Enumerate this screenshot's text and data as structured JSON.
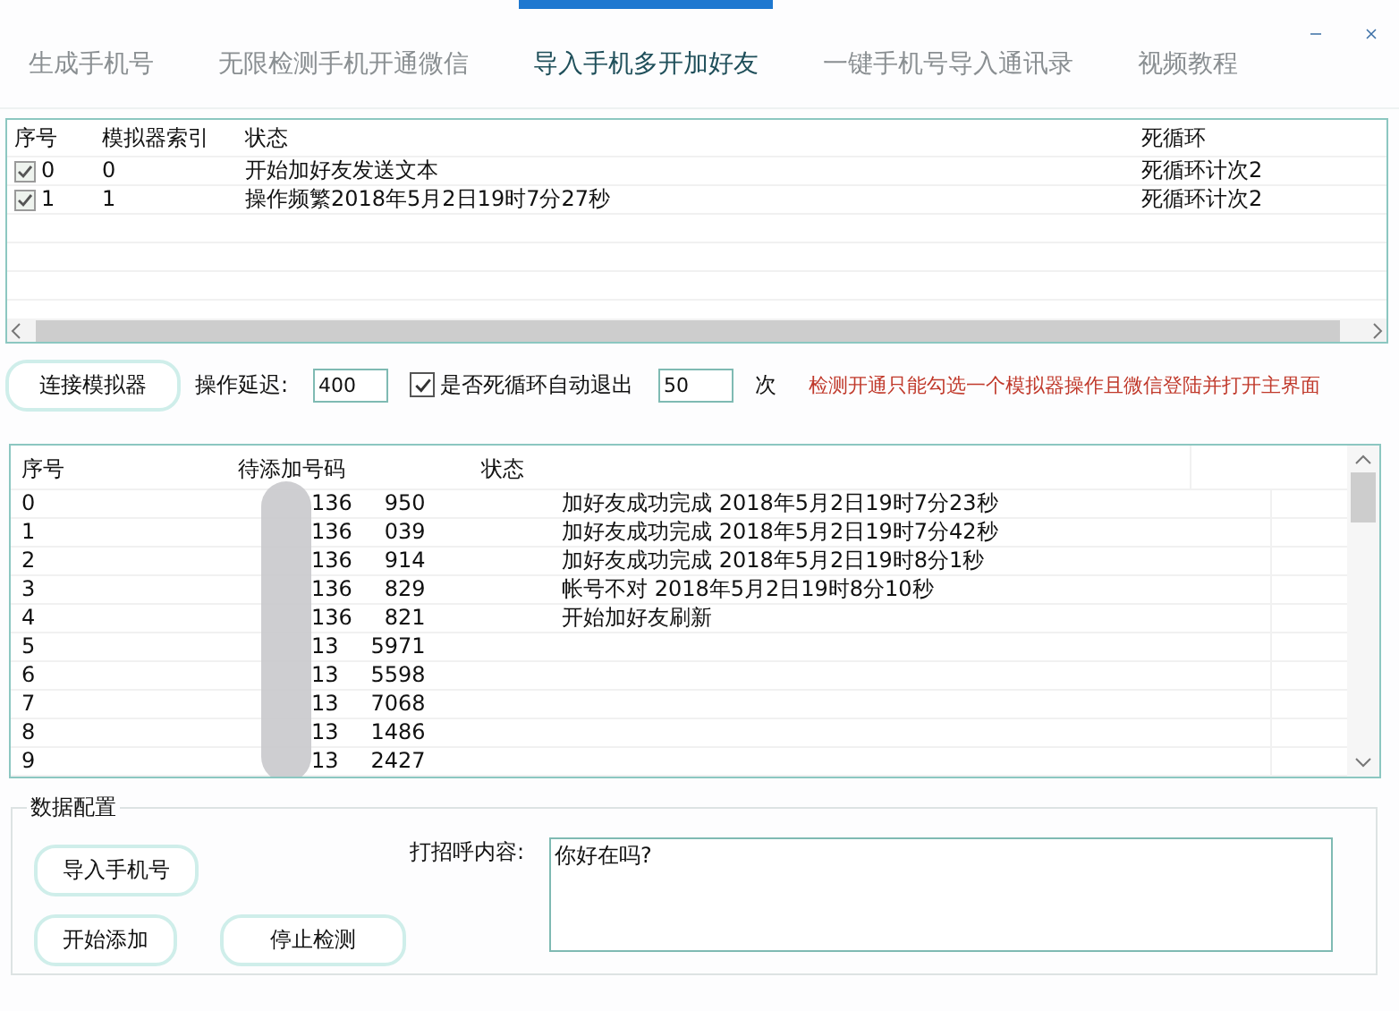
{
  "tabs": [
    {
      "label": "生成手机号",
      "selected": false
    },
    {
      "label": "无限检测手机开通微信",
      "selected": false
    },
    {
      "label": "导入手机多开加好友",
      "selected": true
    },
    {
      "label": "一键手机号导入通讯录",
      "selected": false
    },
    {
      "label": "视频教程",
      "selected": false
    }
  ],
  "emulator_table": {
    "columns": [
      "序号",
      "模拟器索引",
      "状态",
      "死循环"
    ],
    "rows": [
      {
        "checked": true,
        "index": "0",
        "emulator": "0",
        "status": "开始加好友发送文本",
        "loop": "死循环计次2"
      },
      {
        "checked": true,
        "index": "1",
        "emulator": "1",
        "status": "操作频繁2018年5月2日19时7分27秒",
        "loop": "死循环计次2"
      }
    ]
  },
  "controls": {
    "connect_button": "连接模拟器",
    "delay_label": "操作延迟:",
    "delay_value": "400",
    "auto_exit": {
      "label": "是否死循环自动退出",
      "checked": true
    },
    "count_value": "50",
    "count_unit": "次",
    "warning": "检测开通只能勾选一个模拟器操作且微信登陆并打开主界面"
  },
  "number_table": {
    "columns": [
      "序号",
      "待添加号码",
      "状态"
    ],
    "rows": [
      {
        "index": "0",
        "number_start": "136",
        "number_end": "950",
        "status": "加好友成功完成  2018年5月2日19时7分23秒"
      },
      {
        "index": "1",
        "number_start": "136",
        "number_end": "039",
        "status": "加好友成功完成  2018年5月2日19时7分42秒"
      },
      {
        "index": "2",
        "number_start": "136",
        "number_end": "914",
        "status": "加好友成功完成  2018年5月2日19时8分1秒"
      },
      {
        "index": "3",
        "number_start": "136",
        "number_end": "829",
        "status": "帐号不对  2018年5月2日19时8分10秒"
      },
      {
        "index": "4",
        "number_start": "136",
        "number_end": "821",
        "status": "开始加好友刷新"
      },
      {
        "index": "5",
        "number_start": "13",
        "number_end": "5971"
      },
      {
        "index": "6",
        "number_start": "13",
        "number_end": "5598"
      },
      {
        "index": "7",
        "number_start": "13",
        "number_end": "7068"
      },
      {
        "index": "8",
        "number_start": "13",
        "number_end": "1486"
      },
      {
        "index": "9",
        "number_start": "13",
        "number_end": "2427"
      }
    ]
  },
  "data_config": {
    "title": "数据配置",
    "import_button": "导入手机号",
    "start_button": "开始添加",
    "stop_button": "停止检测",
    "greeting_label": "打招呼内容:",
    "greeting_value": "你好在吗?"
  }
}
